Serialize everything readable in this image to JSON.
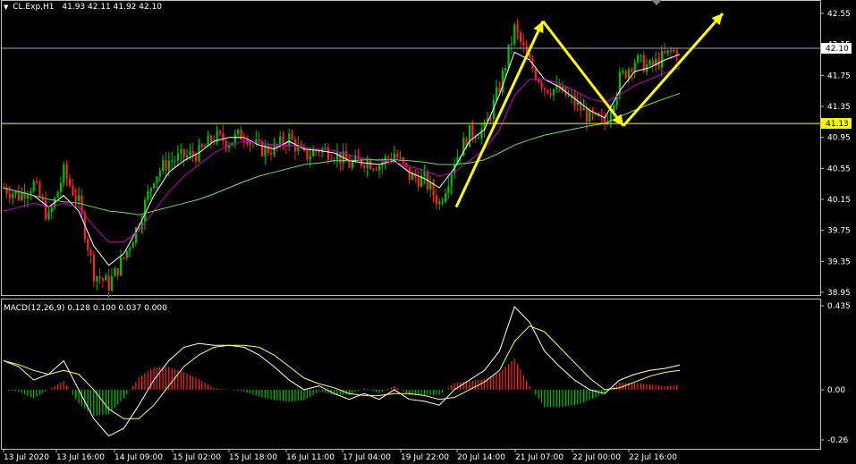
{
  "header": {
    "symbol": "CL.Exp,H1",
    "ohlc": "41.93 42.11 41.92 42.10"
  },
  "macd_header": "MACD(12,26,9) 0.128 0.100 0.037 0.000",
  "colors": {
    "background": "#000000",
    "grid_frame": "#c0c0c0",
    "bull_candle": "#00c000",
    "bear_candle": "#ff2020",
    "ma_fast": "#ffffff",
    "ma_mid": "#c000c0",
    "ma_slow": "#6fd96f",
    "level_line": "#ffff00",
    "arrow": "#ffff00",
    "macd_signal": "#ffff60",
    "bid_line": "#8fa6c8"
  },
  "price_axis": {
    "ticks": [
      "42.55",
      "42.15",
      "41.75",
      "41.35",
      "40.95",
      "40.55",
      "40.15",
      "39.75",
      "39.35",
      "38.95"
    ],
    "current_price_label": "42.10",
    "level_label": "41.13"
  },
  "macd_axis": {
    "ticks": [
      "0.435",
      "0.00",
      "-0.26"
    ]
  },
  "time_axis": {
    "ticks": [
      "13 Jul 2020",
      "13 Jul 16:00",
      "14 Jul 09:00",
      "15 Jul 02:00",
      "15 Jul 18:00",
      "16 Jul 11:00",
      "17 Jul 04:00",
      "19 Jul 22:00",
      "20 Jul 14:00",
      "21 Jul 07:00",
      "22 Jul 00:00",
      "22 Jul 16:00"
    ]
  },
  "chart_data": [
    {
      "type": "candlestick",
      "title": "CL.Exp,H1",
      "ylim": [
        38.95,
        42.6
      ],
      "x_ticks": [
        "13 Jul 2020",
        "13 Jul 16:00",
        "14 Jul 09:00",
        "15 Jul 02:00",
        "15 Jul 18:00",
        "16 Jul 11:00",
        "17 Jul 04:00",
        "19 Jul 22:00",
        "20 Jul 14:00",
        "21 Jul 07:00",
        "22 Jul 00:00",
        "22 Jul 16:00"
      ],
      "close_path": [
        40.3,
        40.2,
        40.35,
        39.9,
        40.5,
        40.1,
        39.2,
        39.05,
        39.4,
        39.85,
        40.45,
        40.65,
        40.7,
        40.75,
        40.95,
        40.9,
        41.0,
        40.8,
        40.8,
        40.95,
        40.7,
        40.8,
        40.75,
        40.6,
        40.65,
        40.6,
        40.75,
        40.45,
        40.4,
        40.1,
        40.65,
        41.0,
        41.05,
        41.6,
        42.35,
        41.9,
        41.6,
        41.55,
        41.4,
        41.2,
        41.13,
        41.7,
        41.95,
        41.85,
        42.0,
        42.1
      ],
      "moving_averages": [
        {
          "points": [
            40.3,
            40.25,
            40.2,
            40.05,
            40.2,
            40.0,
            39.55,
            39.3,
            39.45,
            39.8,
            40.2,
            40.5,
            40.65,
            40.75,
            40.9,
            40.95,
            40.95,
            40.85,
            40.8,
            40.9,
            40.8,
            40.78,
            40.75,
            40.65,
            40.62,
            40.6,
            40.65,
            40.5,
            40.42,
            40.3,
            40.55,
            40.9,
            41.05,
            41.5,
            42.05,
            41.95,
            41.7,
            41.6,
            41.45,
            41.3,
            41.2,
            41.55,
            41.8,
            41.85,
            41.95,
            42.02
          ]
        },
        {
          "points": [
            40.0,
            40.05,
            40.1,
            40.05,
            40.1,
            40.05,
            39.8,
            39.6,
            39.6,
            39.75,
            40.0,
            40.25,
            40.45,
            40.6,
            40.75,
            40.85,
            40.9,
            40.88,
            40.85,
            40.85,
            40.82,
            40.8,
            40.78,
            40.72,
            40.68,
            40.65,
            40.63,
            40.58,
            40.52,
            40.45,
            40.5,
            40.65,
            40.8,
            41.05,
            41.5,
            41.7,
            41.7,
            41.65,
            41.55,
            41.45,
            41.4,
            41.5,
            41.62,
            41.7,
            41.78,
            41.85
          ]
        },
        {
          "points": [
            40.3,
            40.25,
            40.2,
            40.15,
            40.12,
            40.1,
            40.05,
            40.0,
            39.98,
            39.95,
            40.0,
            40.05,
            40.1,
            40.15,
            40.22,
            40.3,
            40.38,
            40.45,
            40.5,
            40.55,
            40.6,
            40.62,
            40.65,
            40.65,
            40.66,
            40.66,
            40.66,
            40.65,
            40.63,
            40.6,
            40.6,
            40.62,
            40.66,
            40.75,
            40.85,
            40.92,
            40.98,
            41.02,
            41.06,
            41.1,
            41.13,
            41.22,
            41.3,
            41.38,
            41.45,
            41.52
          ]
        }
      ],
      "horizontal_levels": [
        41.13,
        42.1
      ],
      "annotations": [
        "zigzag up-down-up arrows"
      ]
    },
    {
      "type": "bar+line",
      "title": "MACD(12,26,9) 0.128 0.100 0.037 0.000",
      "ylim": [
        -0.26,
        0.435
      ],
      "values_macd_line": [
        0.15,
        0.12,
        0.05,
        0.08,
        0.15,
        0.0,
        -0.15,
        -0.24,
        -0.2,
        -0.08,
        0.05,
        0.15,
        0.22,
        0.24,
        0.23,
        0.23,
        0.22,
        0.18,
        0.12,
        0.05,
        0.0,
        0.02,
        -0.02,
        -0.05,
        -0.02,
        -0.05,
        0.0,
        -0.05,
        -0.06,
        -0.08,
        0.0,
        0.05,
        0.1,
        0.2,
        0.43,
        0.35,
        0.2,
        0.12,
        0.05,
        0.0,
        -0.02,
        0.05,
        0.08,
        0.1,
        0.11,
        0.128
      ],
      "values_signal_line": [
        0.15,
        0.13,
        0.1,
        0.08,
        0.1,
        0.08,
        0.0,
        -0.1,
        -0.15,
        -0.15,
        -0.08,
        0.02,
        0.12,
        0.18,
        0.22,
        0.23,
        0.23,
        0.22,
        0.18,
        0.12,
        0.06,
        0.03,
        0.01,
        -0.02,
        -0.03,
        -0.03,
        -0.02,
        -0.02,
        -0.03,
        -0.05,
        -0.04,
        0.0,
        0.04,
        0.1,
        0.25,
        0.33,
        0.3,
        0.22,
        0.14,
        0.06,
        0.0,
        0.01,
        0.04,
        0.07,
        0.09,
        0.1
      ]
    }
  ]
}
